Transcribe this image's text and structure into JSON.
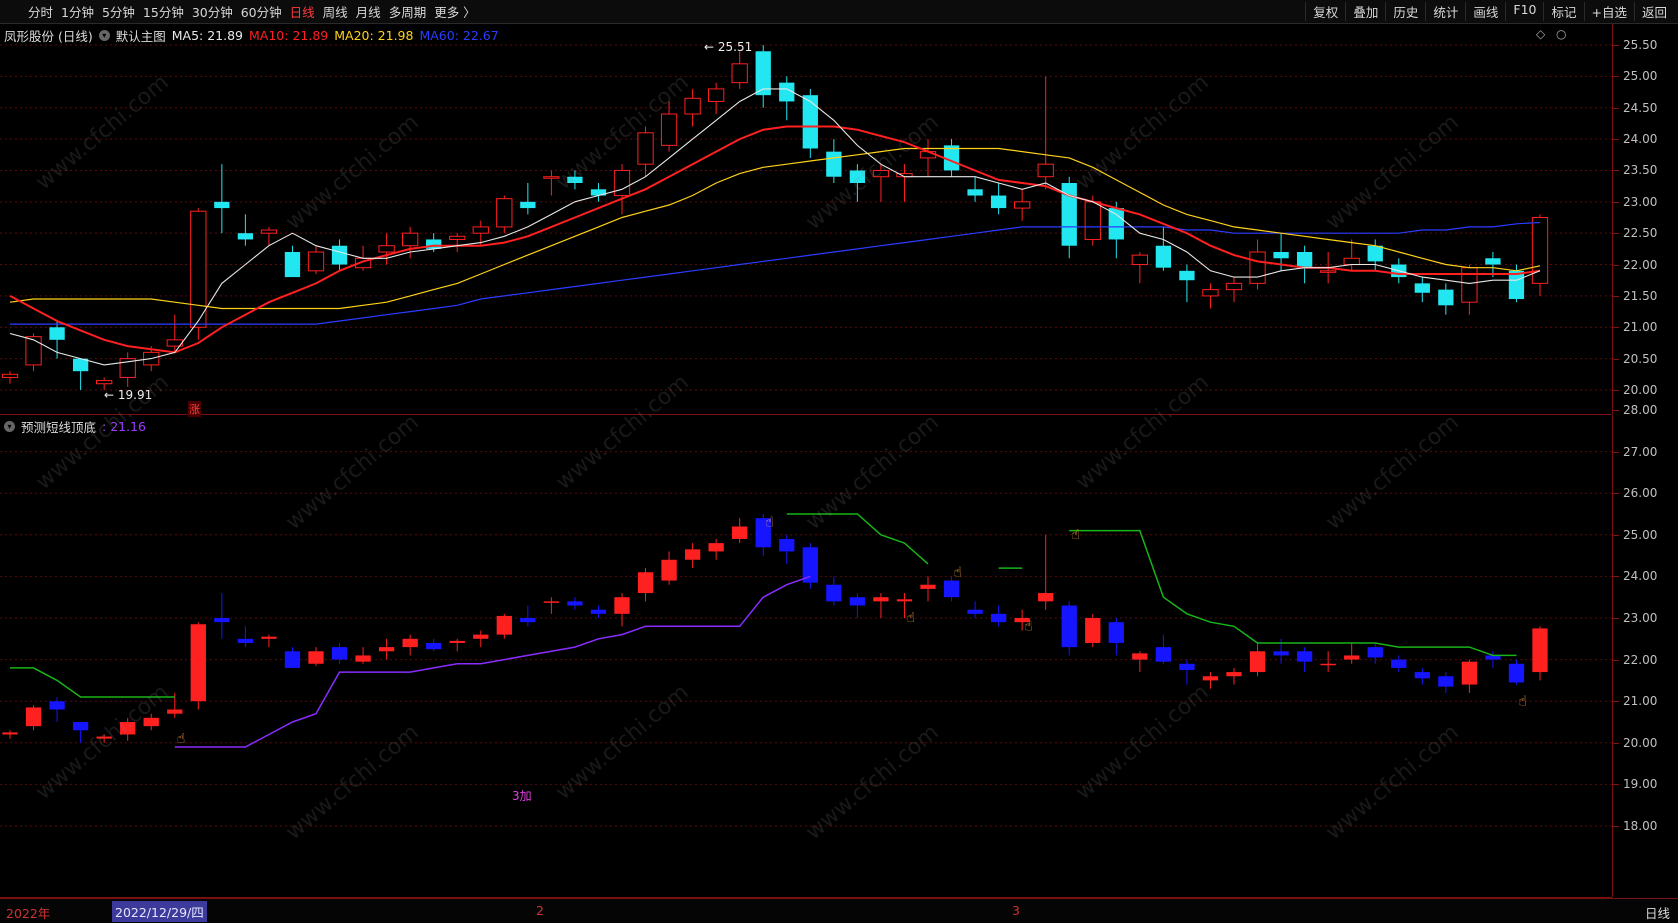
{
  "toolbar": {
    "periods": [
      "分时",
      "1分钟",
      "5分钟",
      "15分钟",
      "30分钟",
      "60分钟",
      "日线",
      "周线",
      "月线",
      "多周期",
      "更多 〉"
    ],
    "active_period": "日线",
    "actions": [
      "复权",
      "叠加",
      "历史",
      "统计",
      "画线",
      "F10",
      "标记",
      "+自选",
      "返回"
    ]
  },
  "main": {
    "title": "凤形股份 (日线)",
    "template": "默认主图",
    "ma": [
      {
        "label": "MA5: 21.89",
        "color": "#e8e8e8"
      },
      {
        "label": "MA10: 21.89",
        "color": "#ff2020"
      },
      {
        "label": "MA20: 21.98",
        "color": "#ffd21a"
      },
      {
        "label": "MA60: 22.67",
        "color": "#2a3cff"
      }
    ],
    "high_mark": "← 25.51",
    "low_mark": "← 19.91",
    "zhang_label": "涨",
    "axis": [
      "25.50",
      "25.00",
      "24.50",
      "24.00",
      "23.50",
      "23.00",
      "22.50",
      "22.00",
      "21.50",
      "21.00",
      "20.50",
      "20.00"
    ]
  },
  "indicator": {
    "name": "预测短线顶底",
    "value": ": 21.16",
    "value_color": "#9b3cff",
    "axis": [
      "28.00",
      "27.00",
      "26.00",
      "25.00",
      "24.00",
      "23.00",
      "22.00",
      "21.00",
      "20.00",
      "19.00",
      "18.00"
    ],
    "jia_label": "3加"
  },
  "bottom": {
    "year_label": "2022年",
    "cursor_date": "2022/12/29/四",
    "month2": "2",
    "month3": "3",
    "period_label": "日线"
  },
  "colors": {
    "up": "#ff2020",
    "down_main": "#22e6f0",
    "down_ind": "#1515ff",
    "grid": "#5a0b0b"
  },
  "watermark": "www.cfchi.com",
  "chart_data": {
    "type": "candlestick",
    "ohlc": [
      [
        20.2,
        20.3,
        20.1,
        20.25
      ],
      [
        20.4,
        20.9,
        20.3,
        20.85
      ],
      [
        21.0,
        21.1,
        20.5,
        20.8
      ],
      [
        20.5,
        20.5,
        20.0,
        20.3
      ],
      [
        20.1,
        20.2,
        20.0,
        20.15
      ],
      [
        20.2,
        20.6,
        20.05,
        20.5
      ],
      [
        20.4,
        20.7,
        20.3,
        20.6
      ],
      [
        20.7,
        21.2,
        20.6,
        20.8
      ],
      [
        21.0,
        22.9,
        20.8,
        22.85
      ],
      [
        23.0,
        23.6,
        22.5,
        22.9
      ],
      [
        22.5,
        22.8,
        22.3,
        22.4
      ],
      [
        22.5,
        22.6,
        22.3,
        22.55
      ],
      [
        22.2,
        22.3,
        21.8,
        21.8
      ],
      [
        21.9,
        22.3,
        21.85,
        22.2
      ],
      [
        22.3,
        22.4,
        21.9,
        22.0
      ],
      [
        21.95,
        22.3,
        21.9,
        22.1
      ],
      [
        22.2,
        22.5,
        22.0,
        22.3
      ],
      [
        22.3,
        22.6,
        22.1,
        22.5
      ],
      [
        22.4,
        22.5,
        22.2,
        22.25
      ],
      [
        22.4,
        22.5,
        22.2,
        22.45
      ],
      [
        22.5,
        22.7,
        22.3,
        22.6
      ],
      [
        22.6,
        23.1,
        22.5,
        23.05
      ],
      [
        23.0,
        23.3,
        22.8,
        22.9
      ],
      [
        23.4,
        23.5,
        23.1,
        23.4
      ],
      [
        23.4,
        23.5,
        23.2,
        23.3
      ],
      [
        23.2,
        23.3,
        23.0,
        23.1
      ],
      [
        23.1,
        23.6,
        22.8,
        23.5
      ],
      [
        23.6,
        24.2,
        23.4,
        24.1
      ],
      [
        23.9,
        24.6,
        23.8,
        24.4
      ],
      [
        24.4,
        24.8,
        24.2,
        24.65
      ],
      [
        24.6,
        24.9,
        24.4,
        24.8
      ],
      [
        24.9,
        25.4,
        24.8,
        25.2
      ],
      [
        25.4,
        25.5,
        24.5,
        24.7
      ],
      [
        24.9,
        25.0,
        24.3,
        24.6
      ],
      [
        24.7,
        24.8,
        23.7,
        23.85
      ],
      [
        23.8,
        24.0,
        23.3,
        23.4
      ],
      [
        23.5,
        23.6,
        23.0,
        23.3
      ],
      [
        23.4,
        23.6,
        23.0,
        23.5
      ],
      [
        23.4,
        23.6,
        23.0,
        23.45
      ],
      [
        23.7,
        24.0,
        23.4,
        23.8
      ],
      [
        23.9,
        24.0,
        23.4,
        23.5
      ],
      [
        23.2,
        23.4,
        23.0,
        23.1
      ],
      [
        23.1,
        23.3,
        22.8,
        22.9
      ],
      [
        22.9,
        23.2,
        22.7,
        23.0
      ],
      [
        23.4,
        25.0,
        23.2,
        23.6
      ],
      [
        23.3,
        23.4,
        22.1,
        22.3
      ],
      [
        22.4,
        23.1,
        22.3,
        23.0
      ],
      [
        22.9,
        23.0,
        22.1,
        22.4
      ],
      [
        22.0,
        22.2,
        21.7,
        22.15
      ],
      [
        22.3,
        22.6,
        21.9,
        21.95
      ],
      [
        21.9,
        22.0,
        21.4,
        21.75
      ],
      [
        21.5,
        21.7,
        21.3,
        21.6
      ],
      [
        21.6,
        21.8,
        21.4,
        21.7
      ],
      [
        21.7,
        22.4,
        21.6,
        22.2
      ],
      [
        22.2,
        22.5,
        21.9,
        22.1
      ],
      [
        22.2,
        22.3,
        21.7,
        21.95
      ],
      [
        21.9,
        22.2,
        21.7,
        21.9
      ],
      [
        22.0,
        22.4,
        21.9,
        22.1
      ],
      [
        22.3,
        22.4,
        21.9,
        22.05
      ],
      [
        22.0,
        22.1,
        21.7,
        21.8
      ],
      [
        21.7,
        21.8,
        21.4,
        21.55
      ],
      [
        21.6,
        21.7,
        21.2,
        21.35
      ],
      [
        21.4,
        22.0,
        21.2,
        21.95
      ],
      [
        22.1,
        22.2,
        21.8,
        22.0
      ],
      [
        21.9,
        22.0,
        21.4,
        21.45
      ],
      [
        21.7,
        22.8,
        21.5,
        22.75
      ]
    ],
    "ma5": [
      20.9,
      20.8,
      20.6,
      20.5,
      20.4,
      20.45,
      20.5,
      20.6,
      21.1,
      21.7,
      22.0,
      22.3,
      22.5,
      22.3,
      22.2,
      22.1,
      22.1,
      22.2,
      22.25,
      22.3,
      22.35,
      22.45,
      22.6,
      22.8,
      23.0,
      23.1,
      23.2,
      23.4,
      23.7,
      24.0,
      24.3,
      24.6,
      24.8,
      24.8,
      24.6,
      24.3,
      23.9,
      23.6,
      23.4,
      23.4,
      23.4,
      23.4,
      23.3,
      23.2,
      23.3,
      23.1,
      23.0,
      22.8,
      22.5,
      22.4,
      22.2,
      21.9,
      21.8,
      21.8,
      21.9,
      21.95,
      21.95,
      22.0,
      22.0,
      21.9,
      21.8,
      21.75,
      21.7,
      21.75,
      21.75,
      21.9
    ],
    "ma10": [
      21.5,
      21.3,
      21.1,
      20.95,
      20.8,
      20.7,
      20.65,
      20.6,
      20.75,
      21.0,
      21.2,
      21.4,
      21.55,
      21.7,
      21.9,
      22.05,
      22.15,
      22.25,
      22.3,
      22.3,
      22.3,
      22.35,
      22.45,
      22.6,
      22.75,
      22.9,
      23.05,
      23.2,
      23.4,
      23.6,
      23.8,
      24.0,
      24.15,
      24.2,
      24.2,
      24.2,
      24.15,
      24.05,
      23.95,
      23.8,
      23.65,
      23.5,
      23.35,
      23.3,
      23.25,
      23.1,
      23.0,
      22.9,
      22.8,
      22.65,
      22.5,
      22.3,
      22.15,
      22.05,
      22.0,
      21.95,
      21.95,
      21.9,
      21.9,
      21.85,
      21.85,
      21.85,
      21.85,
      21.85,
      21.85,
      21.9
    ],
    "ma20": [
      21.4,
      21.45,
      21.45,
      21.45,
      21.45,
      21.45,
      21.45,
      21.4,
      21.35,
      21.3,
      21.3,
      21.3,
      21.3,
      21.3,
      21.3,
      21.35,
      21.4,
      21.5,
      21.6,
      21.7,
      21.85,
      22.0,
      22.15,
      22.3,
      22.45,
      22.6,
      22.75,
      22.85,
      22.95,
      23.1,
      23.3,
      23.45,
      23.55,
      23.6,
      23.65,
      23.7,
      23.75,
      23.8,
      23.85,
      23.85,
      23.85,
      23.85,
      23.85,
      23.8,
      23.75,
      23.7,
      23.55,
      23.35,
      23.15,
      22.95,
      22.8,
      22.7,
      22.6,
      22.55,
      22.5,
      22.45,
      22.4,
      22.35,
      22.3,
      22.2,
      22.1,
      22.0,
      21.95,
      21.95,
      21.9,
      21.98
    ],
    "ma60": [
      21.05,
      21.05,
      21.05,
      21.05,
      21.05,
      21.05,
      21.05,
      21.05,
      21.05,
      21.05,
      21.05,
      21.05,
      21.05,
      21.05,
      21.1,
      21.15,
      21.2,
      21.25,
      21.3,
      21.35,
      21.45,
      21.5,
      21.55,
      21.6,
      21.65,
      21.7,
      21.75,
      21.8,
      21.85,
      21.9,
      21.95,
      22.0,
      22.05,
      22.1,
      22.15,
      22.2,
      22.25,
      22.3,
      22.35,
      22.4,
      22.45,
      22.5,
      22.55,
      22.6,
      22.6,
      22.6,
      22.6,
      22.6,
      22.6,
      22.6,
      22.55,
      22.55,
      22.5,
      22.5,
      22.5,
      22.5,
      22.5,
      22.5,
      22.5,
      22.5,
      22.55,
      22.55,
      22.6,
      22.6,
      22.65,
      22.67
    ],
    "bottom_line": [
      null,
      null,
      null,
      null,
      null,
      null,
      null,
      19.9,
      19.9,
      19.9,
      19.9,
      20.2,
      20.5,
      20.7,
      21.7,
      21.7,
      21.7,
      21.7,
      21.8,
      21.9,
      21.9,
      22.0,
      22.1,
      22.2,
      22.3,
      22.5,
      22.6,
      22.8,
      22.8,
      22.8,
      22.8,
      22.8,
      23.5,
      23.8,
      24.0,
      null,
      null,
      null,
      null,
      null,
      null,
      null,
      null,
      null,
      null,
      null,
      null,
      null,
      null,
      null,
      null,
      null,
      null,
      null,
      null,
      null,
      null,
      null,
      null,
      null,
      null,
      null,
      null,
      null,
      null,
      null
    ],
    "top_line": [
      21.8,
      21.8,
      21.5,
      21.1,
      21.1,
      21.1,
      21.1,
      21.1,
      null,
      null,
      null,
      null,
      null,
      null,
      null,
      null,
      null,
      null,
      null,
      null,
      null,
      null,
      null,
      null,
      null,
      null,
      null,
      null,
      null,
      null,
      null,
      null,
      null,
      25.5,
      25.5,
      25.5,
      25.5,
      25.0,
      24.8,
      24.3,
      null,
      null,
      24.2,
      24.2,
      null,
      25.1,
      25.1,
      25.1,
      25.1,
      23.5,
      23.1,
      22.9,
      22.8,
      22.4,
      22.4,
      22.4,
      22.4,
      22.4,
      22.4,
      22.3,
      22.3,
      22.3,
      22.3,
      22.1,
      22.1,
      null
    ]
  }
}
